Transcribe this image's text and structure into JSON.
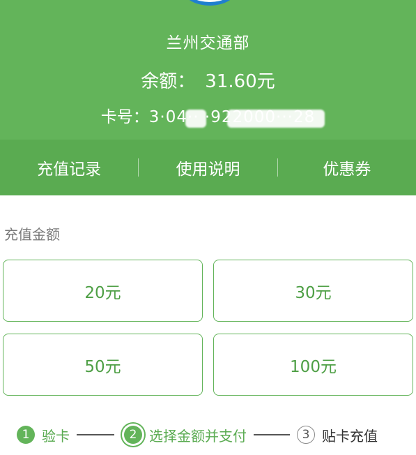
{
  "header": {
    "org_name": "兰州交通部",
    "balance_label": "余额：",
    "balance_value": "31.60元",
    "cardno_label": "卡号：",
    "cardno_value": "3·04·· ·922000···28",
    "bg_color": "#63b45a"
  },
  "menu": {
    "items": [
      {
        "label": "充值记录"
      },
      {
        "label": "使用说明"
      },
      {
        "label": "优惠券"
      }
    ]
  },
  "recharge": {
    "section_label": "充值金额",
    "amounts": [
      {
        "label": "20元"
      },
      {
        "label": "30元"
      },
      {
        "label": "50元"
      },
      {
        "label": "100元"
      }
    ],
    "accent_color": "#63b45a"
  },
  "steps": [
    {
      "number": "1",
      "label": "验卡",
      "state": "done"
    },
    {
      "number": "2",
      "label": "选择金额并支付",
      "state": "active"
    },
    {
      "number": "3",
      "label": "贴卡充值",
      "state": "todo"
    }
  ]
}
